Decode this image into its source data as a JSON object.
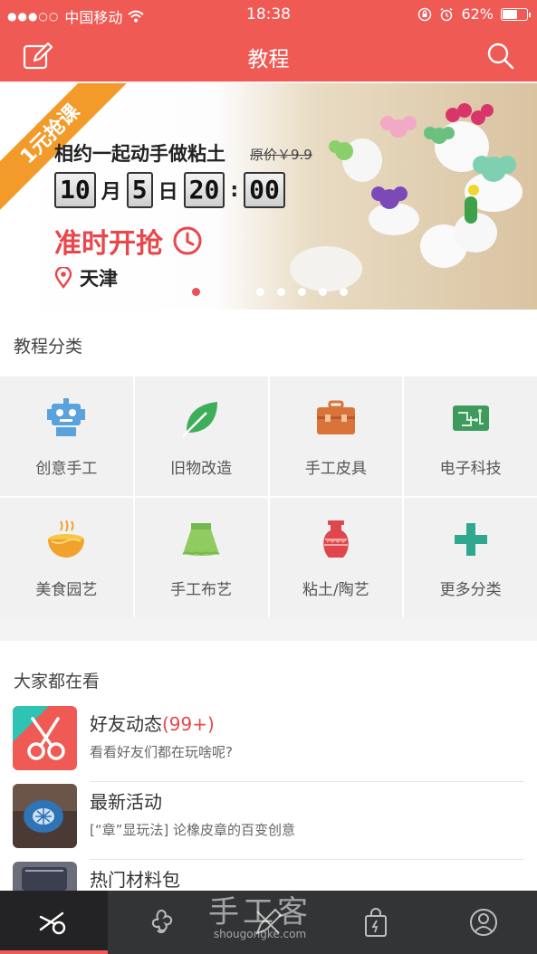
{
  "status_bar": {
    "signal": "●●●○○",
    "carrier": "中国移动",
    "time": "18:38",
    "battery": "62%",
    "battery_level": 0.62
  },
  "header": {
    "title": "教程",
    "left_icon": "edit-icon",
    "right_icon": "search-icon"
  },
  "banner": {
    "ribbon": "1元抢课",
    "title": "相约一起动手做粘土",
    "price": "原价￥9.9",
    "month": "10",
    "month_unit": "月",
    "day": "5",
    "day_unit": "日",
    "hour": "20",
    "colon": ":",
    "minute": "00",
    "cta": "准时开抢",
    "city": "天津",
    "page_count": 6,
    "active_page": 0
  },
  "categories": {
    "section_title": "教程分类",
    "items": [
      {
        "label": "创意手工",
        "icon": "robot-icon"
      },
      {
        "label": "旧物改造",
        "icon": "leaf-icon"
      },
      {
        "label": "手工皮具",
        "icon": "briefcase-icon"
      },
      {
        "label": "电子科技",
        "icon": "circuit-board-icon"
      },
      {
        "label": "美食园艺",
        "icon": "noodle-bowl-icon"
      },
      {
        "label": "手工布艺",
        "icon": "skirt-icon"
      },
      {
        "label": "粘土/陶艺",
        "icon": "vase-icon"
      },
      {
        "label": "更多分类",
        "icon": "plus-icon"
      }
    ]
  },
  "feed": {
    "section_title": "大家都在看",
    "items": [
      {
        "title": "好友动态",
        "count": "(99+)",
        "subtitle": "看看好友们都在玩啥呢?"
      },
      {
        "title": "最新活动",
        "count": "",
        "subtitle": "[“章”显玩法] 论橡皮章的百变创意"
      },
      {
        "title": "热门材料包",
        "count": "",
        "subtitle": ""
      }
    ]
  },
  "tab_bar": {
    "tabs": [
      "scissors-icon",
      "flower-icon",
      "pencil-ruler-icon",
      "shopping-bag-icon",
      "user-icon"
    ],
    "active": 0
  },
  "watermark": {
    "line1": "手工客",
    "line2": "shougongke.com"
  },
  "colors": {
    "brand": "#ef5a55",
    "accent_orange": "#f29b2a",
    "tab_bar": "#333436"
  }
}
